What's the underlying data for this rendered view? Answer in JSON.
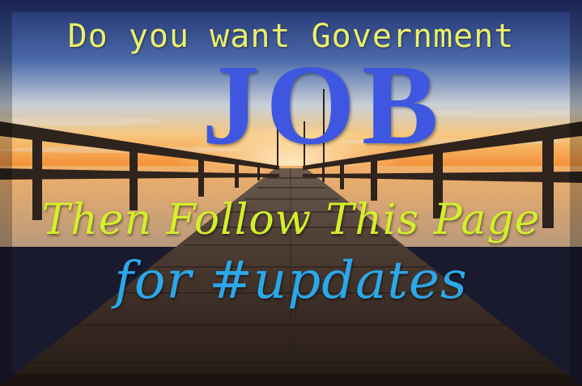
{
  "image": {
    "line_question": "Do you want Government",
    "line_job": "JOB",
    "line_follow": "Then Follow This Page",
    "line_updates": "for #updates"
  },
  "colors": {
    "question_text": "#e9f06a",
    "job_text": "#3f57e0",
    "follow_text": "#d4ef2b",
    "updates_text": "#2ba8ea",
    "sky_top": "#23306e",
    "sky_horizon": "#f6a44a",
    "water": "#c9a57e",
    "boardwalk": "#3a2a22"
  }
}
